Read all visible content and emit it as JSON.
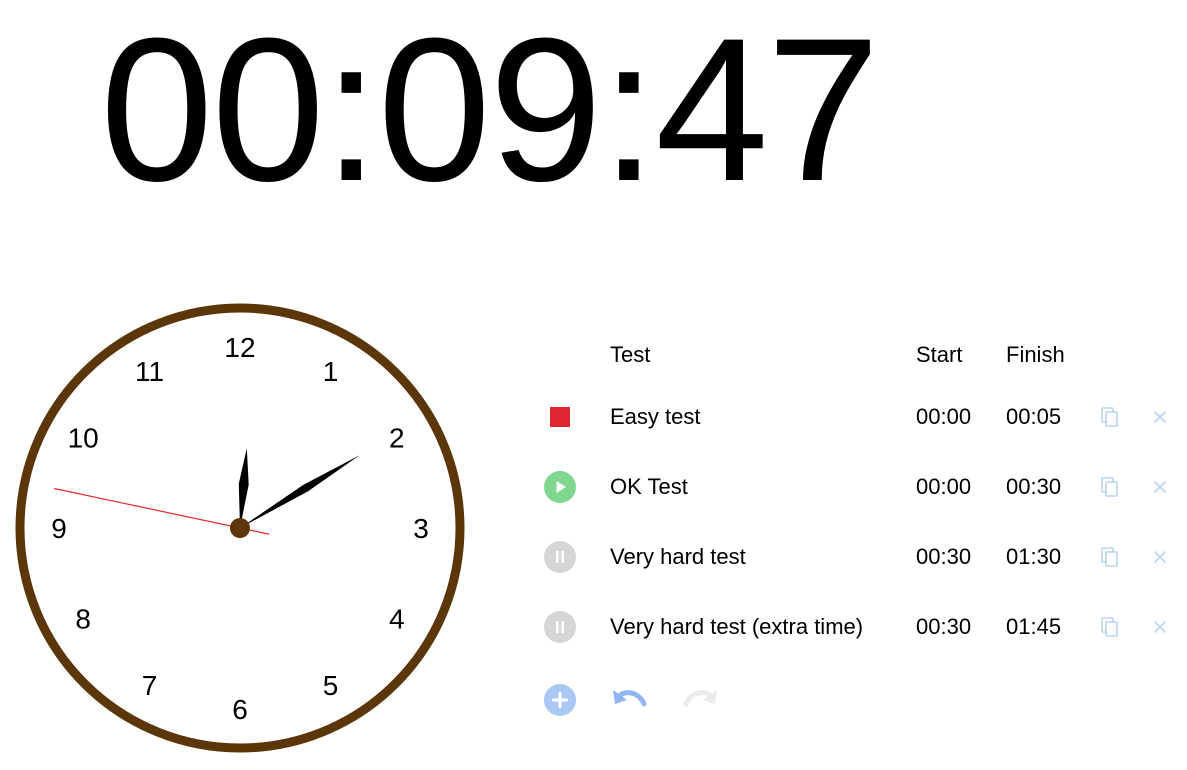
{
  "timer": {
    "display": "00:09:47"
  },
  "clock": {
    "numbers": [
      "12",
      "1",
      "2",
      "3",
      "4",
      "5",
      "6",
      "7",
      "8",
      "9",
      "10",
      "11"
    ],
    "hour": 0,
    "minute": 9,
    "second": 47,
    "rim_color": "#5a3608",
    "hub_color": "#5a3608",
    "second_hand_color": "#e8262e"
  },
  "table": {
    "headers": {
      "test": "Test",
      "start": "Start",
      "finish": "Finish"
    },
    "rows": [
      {
        "status": "stopped",
        "name": "Easy test",
        "start": "00:00",
        "finish": "00:05"
      },
      {
        "status": "play",
        "name": "OK Test",
        "start": "00:00",
        "finish": "00:30"
      },
      {
        "status": "paused",
        "name": "Very hard test",
        "start": "00:30",
        "finish": "01:30"
      },
      {
        "status": "paused",
        "name": "Very hard test (extra time)",
        "start": "00:30",
        "finish": "01:45"
      }
    ]
  },
  "icons": {
    "stopped": "stop-square-icon",
    "play": "play-circle-icon",
    "paused": "pause-circle-icon",
    "copy": "copy-icon",
    "delete": "close-icon",
    "add": "plus-circle-icon",
    "undo": "undo-icon",
    "redo": "redo-icon"
  },
  "colors": {
    "stop": "#e02430",
    "play": "#7fd68f",
    "pause": "#d6d6d8",
    "action_light": "#b9d4f2",
    "add": "#a9c8f4",
    "undo": "#8fb6ee",
    "redo_disabled": "#ebebeb"
  }
}
